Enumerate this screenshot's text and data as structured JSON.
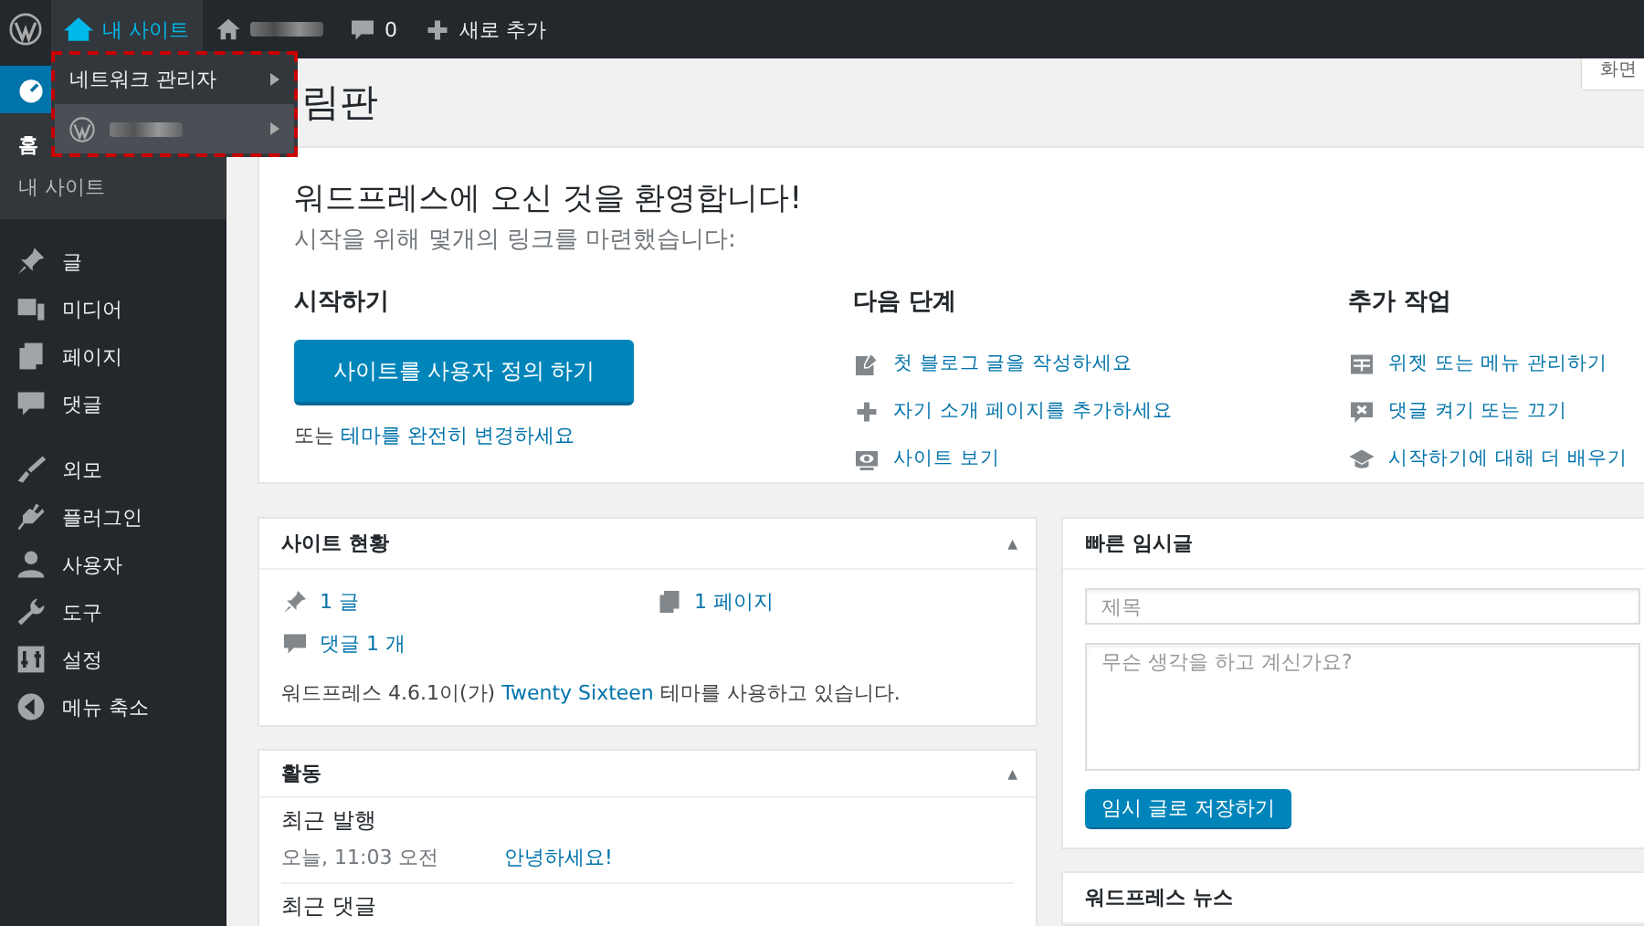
{
  "admin_bar": {
    "my_sites": {
      "label": "내 사이트",
      "selected": true
    },
    "comments": {
      "label": "0"
    },
    "new": {
      "label": "새로 추가"
    }
  },
  "dropdown": [
    {
      "kind": "text",
      "label": "네트워크 관리자",
      "selected": false
    },
    {
      "kind": "site",
      "selected": true
    }
  ],
  "sidebar": {
    "groups": [
      [
        {
          "kind": "dashboard",
          "selected": true,
          "children": [
            {
              "label": "홈",
              "selected": true
            },
            {
              "label": "내 사이트",
              "selected": false
            }
          ]
        }
      ],
      [
        {
          "kind": "pin",
          "label": "글",
          "selected": false
        },
        {
          "kind": "media",
          "label": "미디어",
          "selected": false
        },
        {
          "kind": "pages",
          "label": "페이지",
          "selected": false
        },
        {
          "kind": "comment",
          "label": "댓글",
          "selected": false
        }
      ],
      [
        {
          "kind": "brush",
          "label": "외모",
          "selected": false
        },
        {
          "kind": "plug",
          "label": "플러그인",
          "selected": false
        },
        {
          "kind": "user",
          "label": "사용자",
          "selected": false
        },
        {
          "kind": "wrench",
          "label": "도구",
          "selected": false
        },
        {
          "kind": "sliders",
          "label": "설정",
          "selected": false
        },
        {
          "kind": "collapse",
          "label": "메뉴 축소",
          "selected": false
        }
      ]
    ]
  },
  "page_title": "림판",
  "screen_options": "화면",
  "welcome": {
    "title": "워드프레스에 오신 것을 환영합니다!",
    "subtitle": "시작을 위해 몇개의 링크를 마련했습니다:",
    "columns": [
      {
        "heading": "시작하기",
        "button": "사이트를 사용자 정의 하기",
        "note_prefix": "또는 ",
        "note_link": "테마를 완전히 변경하세요"
      },
      {
        "heading": "다음 단계",
        "links": [
          {
            "kind": "edit",
            "label": "첫 블로그 글을 작성하세요"
          },
          {
            "kind": "plus",
            "label": "자기 소개 페이지를 추가하세요"
          },
          {
            "kind": "view",
            "label": "사이트 보기"
          }
        ]
      },
      {
        "heading": "추가 작업",
        "links": [
          {
            "kind": "widgets",
            "label": "위젯 또는 메뉴 관리하기"
          },
          {
            "kind": "comment-off",
            "label": "댓글 켜기 또는 끄기"
          },
          {
            "kind": "learn",
            "label": "시작하기에 대해 더 배우기"
          }
        ]
      }
    ]
  },
  "site_status": {
    "title": "사이트 현황",
    "toggle": "▲",
    "items": [
      {
        "kind": "pin",
        "label": "1 글"
      },
      {
        "kind": "pages",
        "label": "1 페이지"
      },
      {
        "kind": "comment",
        "label": "댓글 1 개"
      }
    ],
    "footer_prefix": "워드프레스 4.6.1이(가) ",
    "footer_link": "Twenty Sixteen",
    "footer_suffix": " 테마를 사용하고 있습니다."
  },
  "activity": {
    "title": "활동",
    "toggle": "▲",
    "sections": [
      {
        "heading": "최근 발행",
        "rows": [
          {
            "time": "오늘, 11:03 오전",
            "link": "안녕하세요!"
          }
        ]
      },
      {
        "heading": "최근 댓글"
      }
    ]
  },
  "quick_draft": {
    "title": "빠른 임시글",
    "title_field": {
      "placeholder": "제목"
    },
    "content_field": {
      "placeholder": "무슨 생각을 하고 계신가요?"
    },
    "button": "임시 글로 저장하기"
  },
  "news": {
    "title": "워드프레스 뉴스"
  }
}
